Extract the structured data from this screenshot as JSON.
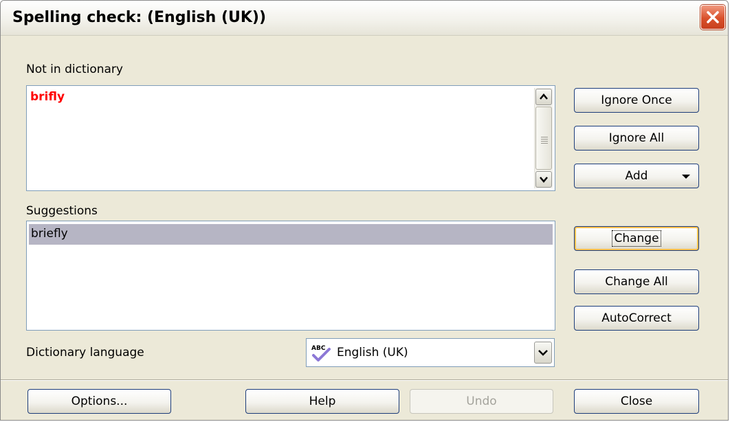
{
  "window": {
    "title": "Spelling check:  (English (UK))"
  },
  "not_in_dictionary": {
    "label": "Not in dictionary",
    "word": "brifly"
  },
  "suggestions": {
    "label": "Suggestions",
    "items": [
      "briefly"
    ],
    "selected": "briefly"
  },
  "dictionary_language": {
    "label": "Dictionary language",
    "value": "English (UK)",
    "icon": "spellcheck-abc-icon"
  },
  "buttons": {
    "ignore_once": "Ignore Once",
    "ignore_all": "Ignore All",
    "add": "Add",
    "change": "Change",
    "change_all": "Change All",
    "autocorrect": "AutoCorrect",
    "options": "Options...",
    "help": "Help",
    "undo": "Undo",
    "close": "Close"
  },
  "colors": {
    "misspelt": "#ff0000",
    "selection": "#b6b5c4",
    "dialog_bg": "#ece9d8",
    "button_border": "#1c3c7a",
    "focus": "#fbc24f"
  }
}
